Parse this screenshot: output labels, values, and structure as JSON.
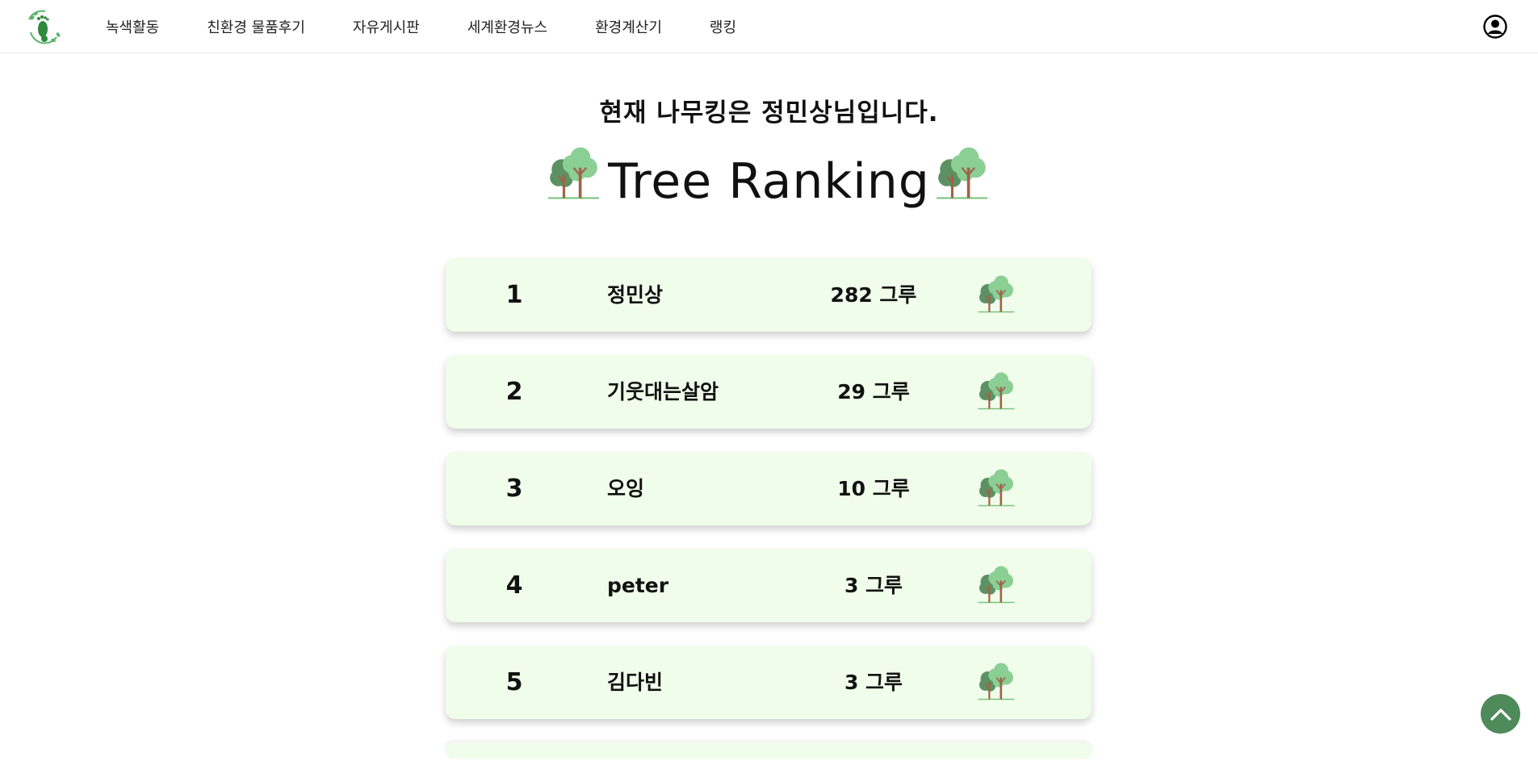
{
  "nav": {
    "items": [
      {
        "label": "녹색활동"
      },
      {
        "label": "친환경 물품후기"
      },
      {
        "label": "자유게시판"
      },
      {
        "label": "세계환경뉴스"
      },
      {
        "label": "환경계산기"
      },
      {
        "label": "랭킹"
      }
    ],
    "logo_icon": "footprint-leaf-logo",
    "profile_icon": "user-circle-icon"
  },
  "page": {
    "king_text": "현재 나무킹은 정민상님입니다.",
    "title": "Tree Ranking",
    "title_icon": "tree-icon"
  },
  "ranking": [
    {
      "rank": "1",
      "name": "정민상",
      "count": "282 그루"
    },
    {
      "rank": "2",
      "name": "기웃대는살암",
      "count": "29 그루"
    },
    {
      "rank": "3",
      "name": "오잉",
      "count": "10 그루"
    },
    {
      "rank": "4",
      "name": "peter",
      "count": "3 그루"
    },
    {
      "rank": "5",
      "name": "김다빈",
      "count": "3 그루"
    }
  ],
  "scroll_top_icon": "chevron-up-icon",
  "colors": {
    "row_bg": "#f1fdeb",
    "accent_green": "#4f8a5b",
    "tree_leaf_light": "#8bcf95",
    "tree_leaf_dark": "#5c9163",
    "tree_trunk": "#a0624a"
  }
}
